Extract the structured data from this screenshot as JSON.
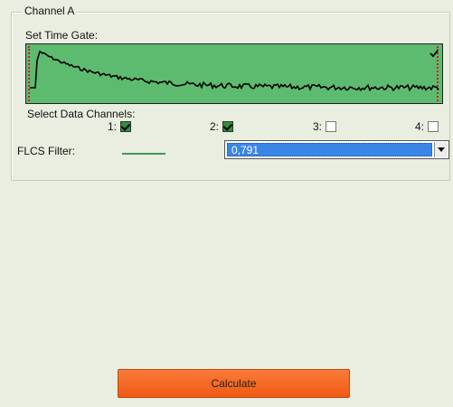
{
  "panel": {
    "group_title": "Channel A",
    "time_gate_label": "Set Time Gate:",
    "select_channels_label": "Select Data Channels:",
    "channels": [
      {
        "label": "1:",
        "checked": true
      },
      {
        "label": "2:",
        "checked": true
      },
      {
        "label": "3:",
        "checked": false
      },
      {
        "label": "4:",
        "checked": false
      }
    ],
    "flcs_filter_label": "FLCS Filter:",
    "flcs_filter_value": "0,791",
    "calculate_label": "Calculate"
  },
  "colors": {
    "plot_background": "#5dbb70",
    "filter_line": "#3e9a55",
    "button": "#f26520",
    "selection": "#3a86e8"
  }
}
